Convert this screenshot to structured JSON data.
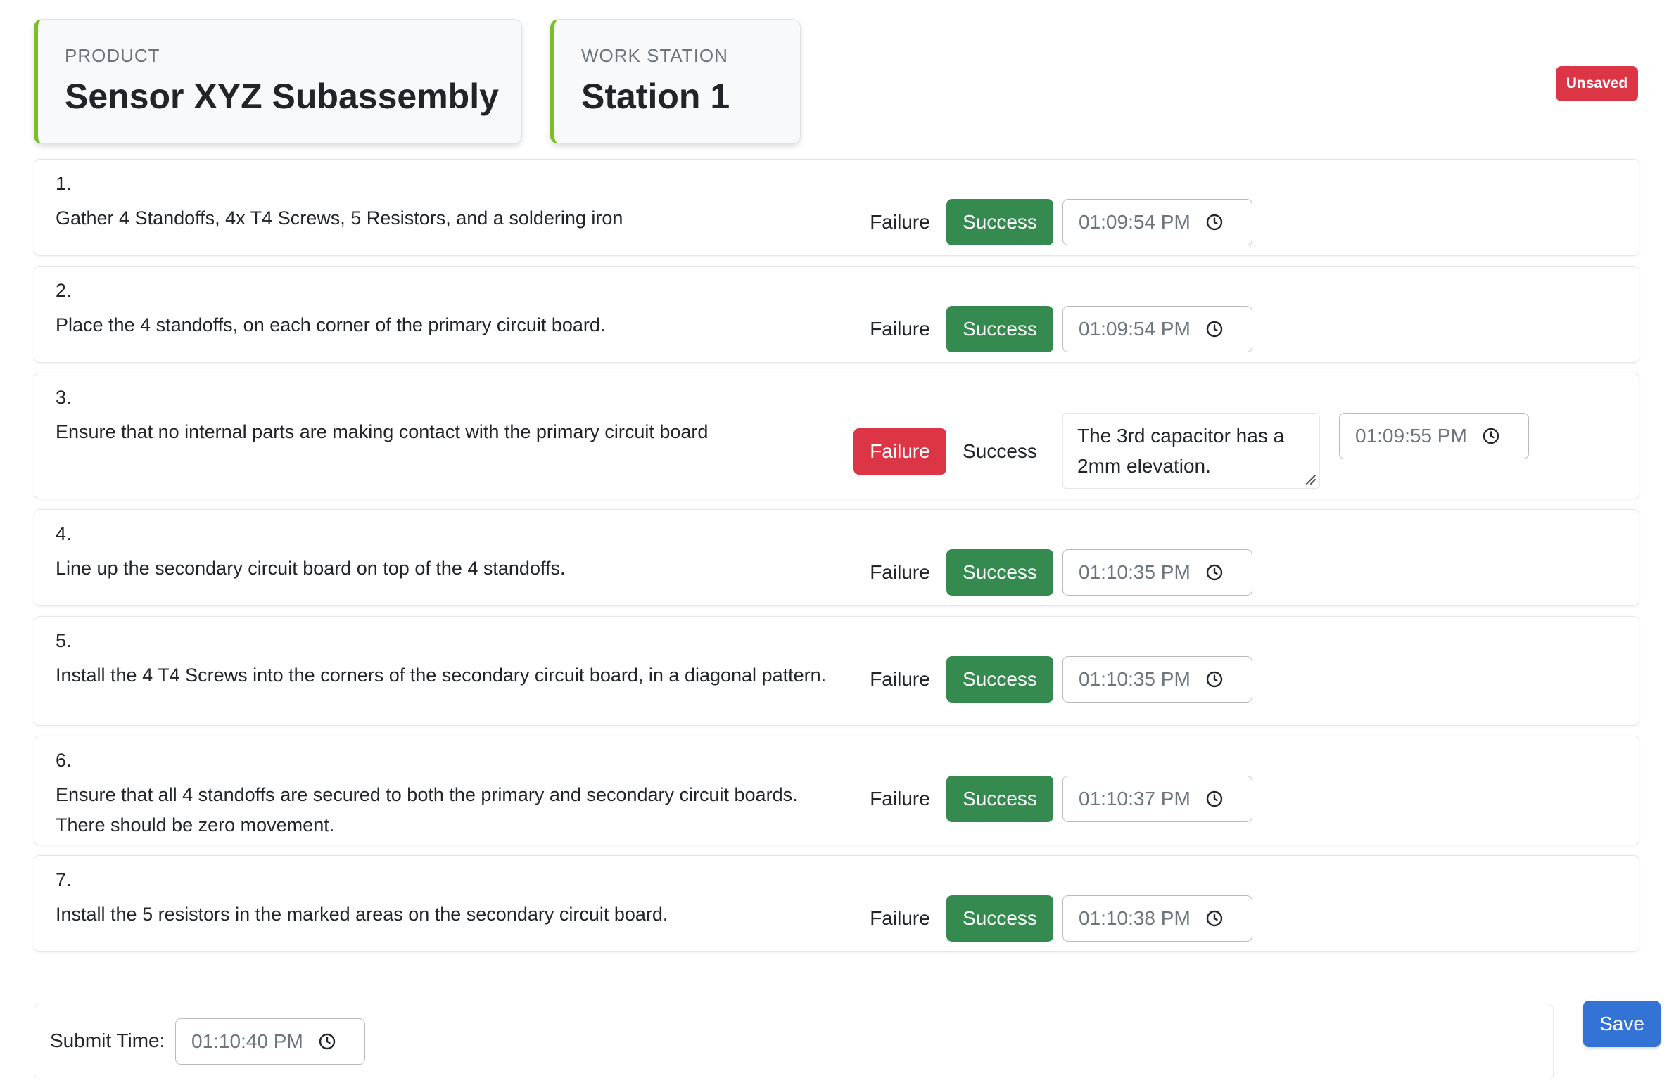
{
  "header": {
    "product_label": "PRODUCT",
    "product_value": "Sensor XYZ Subassembly",
    "station_label": "WORK STATION",
    "station_value": "Station 1",
    "status_badge": "Unsaved"
  },
  "steps": [
    {
      "number": "1.",
      "text": "Gather 4 Standoffs, 4x T4 Screws, 5 Resistors, and a soldering iron",
      "failure_label": "Failure",
      "success_label": "Success",
      "selected": "Success",
      "time": "01:09:54 PM",
      "note": ""
    },
    {
      "number": "2.",
      "text": "Place the 4 standoffs, on each corner of the primary circuit board.",
      "failure_label": "Failure",
      "success_label": "Success",
      "selected": "Success",
      "time": "01:09:54 PM",
      "note": ""
    },
    {
      "number": "3.",
      "text": "Ensure that no internal parts are making contact with the primary circuit board",
      "failure_label": "Failure",
      "success_label": "Success",
      "selected": "Failure",
      "time": "01:09:55 PM",
      "note": "The 3rd capacitor has a 2mm elevation."
    },
    {
      "number": "4.",
      "text": "Line up the secondary circuit board on top of the 4 standoffs.",
      "failure_label": "Failure",
      "success_label": "Success",
      "selected": "Success",
      "time": "01:10:35 PM",
      "note": ""
    },
    {
      "number": "5.",
      "text": "Install the 4 T4 Screws into the corners of the secondary circuit board, in a diagonal pattern.",
      "failure_label": "Failure",
      "success_label": "Success",
      "selected": "Success",
      "time": "01:10:35 PM",
      "note": ""
    },
    {
      "number": "6.",
      "text": "Ensure that all 4 standoffs are secured to both the primary and secondary circuit boards. There should be zero movement.",
      "failure_label": "Failure",
      "success_label": "Success",
      "selected": "Success",
      "time": "01:10:37 PM",
      "note": ""
    },
    {
      "number": "7.",
      "text": "Install the 5 resistors in the marked areas on the secondary circuit board.",
      "failure_label": "Failure",
      "success_label": "Success",
      "selected": "Success",
      "time": "01:10:38 PM",
      "note": ""
    }
  ],
  "footer": {
    "submit_label": "Submit Time:",
    "submit_time": "01:10:40 PM",
    "save_label": "Save"
  },
  "colors": {
    "accent_green": "#7cbd2a",
    "success": "#348a4f",
    "failure": "#dc3545",
    "save": "#3373d6",
    "unsaved": "#dc3545"
  },
  "icons": {
    "time": "clock-icon",
    "resize": "resize-handle-icon"
  }
}
